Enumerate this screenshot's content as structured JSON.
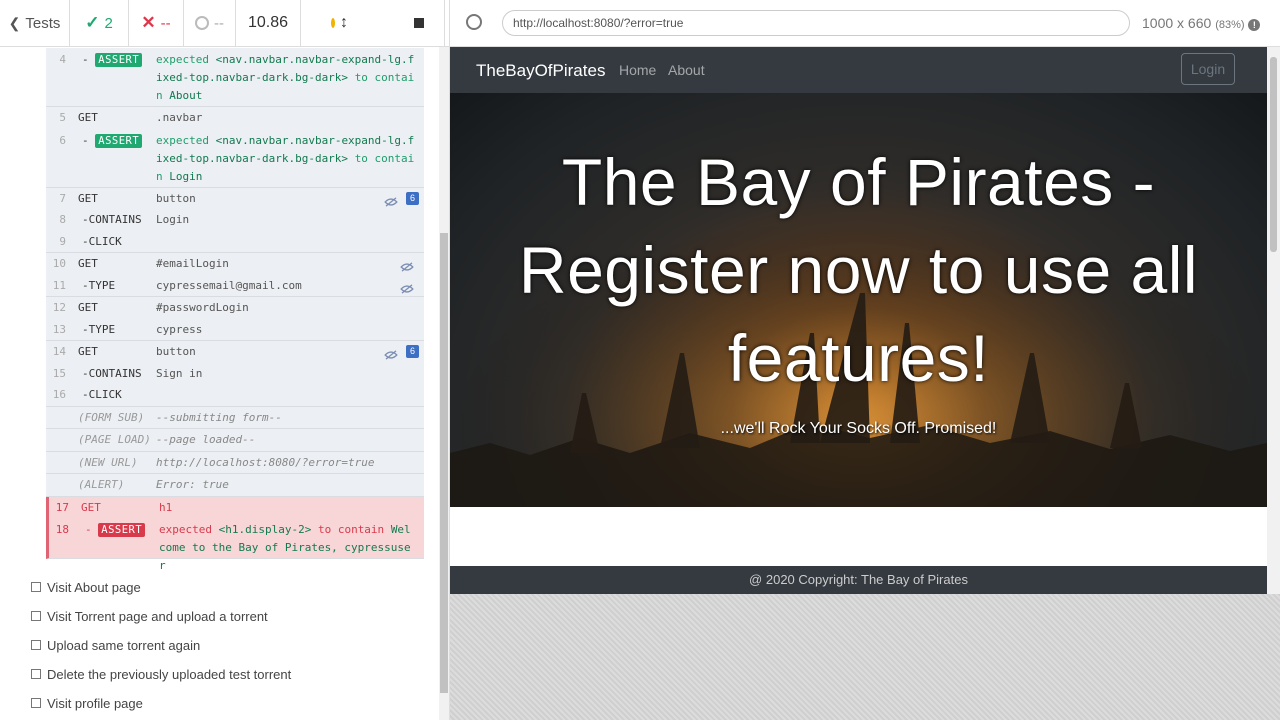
{
  "reporter": {
    "back": "Tests",
    "passed": "2",
    "failed": "--",
    "pending": "--",
    "duration": "10.86"
  },
  "commands": [
    {
      "n": "4",
      "name": "-",
      "badge": "ASSERT",
      "pre": "expected",
      "el": "<nav.navbar.navbar-expand-lg.fixed-top.navbar-dark.bg-dark>",
      "mid": "to contain",
      "val": "About"
    },
    {
      "n": "5",
      "name": "GET",
      "msg": ".navbar"
    },
    {
      "n": "6",
      "name": "-",
      "badge": "ASSERT",
      "pre": "expected",
      "el": "<nav.navbar.navbar-expand-lg.fixed-top.navbar-dark.bg-dark>",
      "mid": "to contain",
      "val": "Login"
    },
    {
      "n": "7",
      "name": "GET",
      "msg": "button",
      "count": "6"
    },
    {
      "n": "8",
      "name": "-CONTAINS",
      "msg": "Login"
    },
    {
      "n": "9",
      "name": "-CLICK",
      "msg": ""
    },
    {
      "n": "10",
      "name": "GET",
      "msg": "#emailLogin"
    },
    {
      "n": "11",
      "name": "-TYPE",
      "msg": "cypressemail@gmail.com"
    },
    {
      "n": "12",
      "name": "GET",
      "msg": "#passwordLogin"
    },
    {
      "n": "13",
      "name": "-TYPE",
      "msg": "cypress"
    },
    {
      "n": "14",
      "name": "GET",
      "msg": "button",
      "count": "6"
    },
    {
      "n": "15",
      "name": "-CONTAINS",
      "msg": "Sign in"
    },
    {
      "n": "16",
      "name": "-CLICK",
      "msg": ""
    },
    {
      "name": "(FORM SUB)",
      "msg": "--submitting form--"
    },
    {
      "name": "(PAGE LOAD)",
      "msg": "--page loaded--"
    },
    {
      "name": "(NEW URL)",
      "msg": "http://localhost:8080/?error=true"
    },
    {
      "name": "(ALERT)",
      "msg": "Error: true"
    },
    {
      "n": "17",
      "name": "GET",
      "msg": "h1"
    },
    {
      "n": "18",
      "name": "-",
      "badge": "ASSERT",
      "pre": "expected",
      "el": "<h1.display-2>",
      "mid": "to contain",
      "val": "Welcome to the Bay of Pirates, cypressuser"
    }
  ],
  "tests": [
    "Visit About page",
    "Visit Torrent page and upload a torrent",
    "Upload same torrent again",
    "Delete the previously uploaded test torrent",
    "Visit profile page"
  ],
  "browser": {
    "url": "http://localhost:8080/?error=true",
    "size": "1000 x 660",
    "scale": "(83%)"
  },
  "site": {
    "brand": "TheBayOfPirates",
    "nav": [
      "Home",
      "About"
    ],
    "login": "Login",
    "hero_title": "The Bay of Pirates - Register now to use all features!",
    "hero_tagline": "...we'll Rock Your Socks Off. Promised!",
    "footer": "@ 2020 Copyright: The Bay of Pirates"
  }
}
